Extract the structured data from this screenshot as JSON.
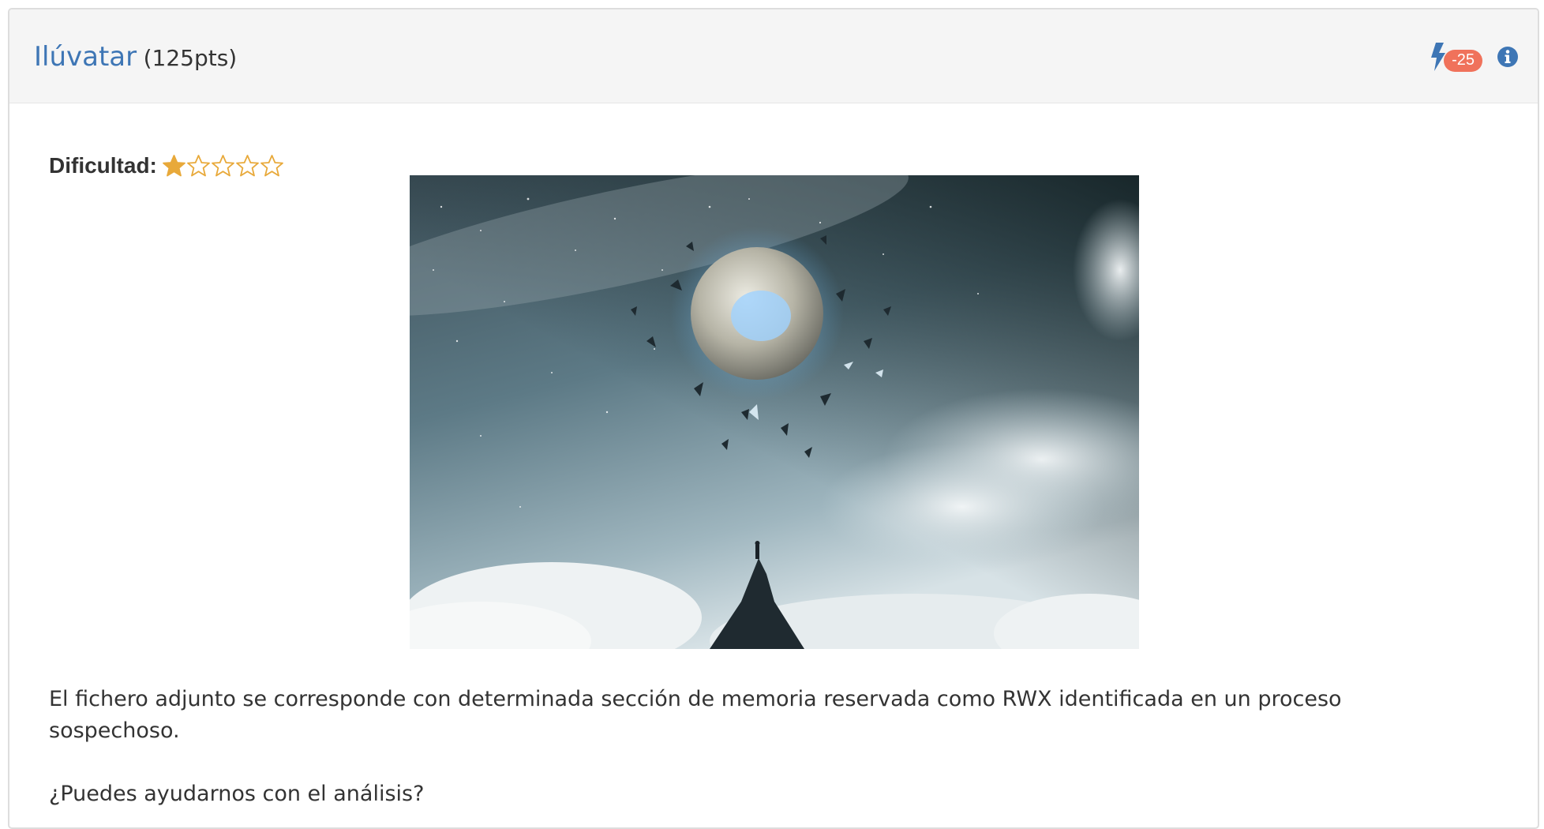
{
  "challenge": {
    "title": "Ilúvatar",
    "points": "(125pts)",
    "penalty_badge": "-25",
    "penalty_icon": "bolt-icon",
    "info_icon": "info-circle-icon",
    "difficulty_label": "Dificultad:",
    "difficulty_rating": 1,
    "difficulty_max": 5,
    "description_paragraph_1": "El fichero adjunto se corresponde con determinada sección de memoria reservada como RWX identificada en un proceso sospechoso.",
    "description_paragraph_2": "¿Puedes ayudarnos con el análisis?"
  },
  "colors": {
    "link": "#3e76b5",
    "badge": "#f0725b",
    "star": "#e8a93a",
    "header_bg": "#f5f5f5",
    "text": "#333333"
  }
}
